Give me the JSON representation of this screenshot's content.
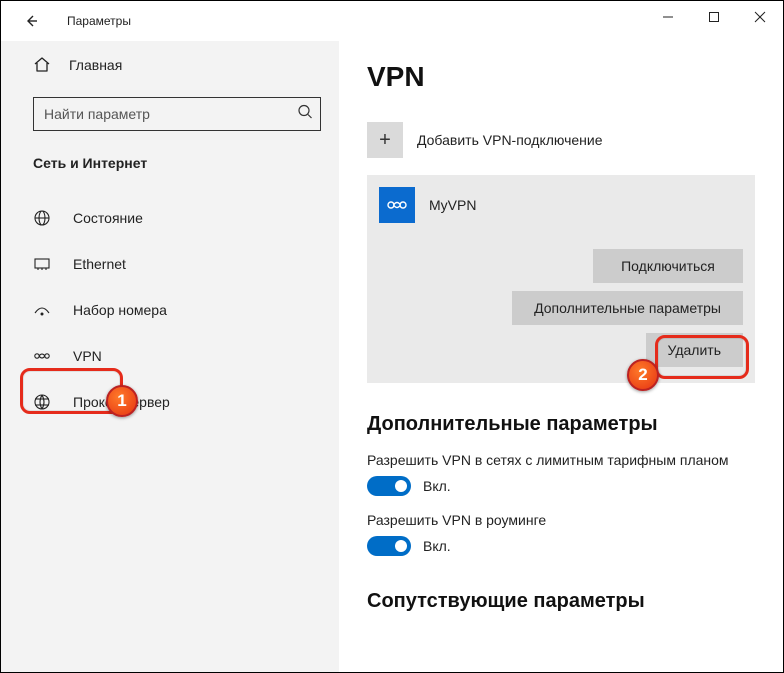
{
  "titlebar": {
    "title": "Параметры"
  },
  "sidebar": {
    "home_label": "Главная",
    "search_placeholder": "Найти параметр",
    "section_title": "Сеть и Интернет",
    "items": [
      {
        "label": "Состояние"
      },
      {
        "label": "Ethernet"
      },
      {
        "label": "Набор номера"
      },
      {
        "label": "VPN"
      },
      {
        "label": "Прокси-сервер"
      }
    ]
  },
  "content": {
    "heading": "VPN",
    "add_vpn_label": "Добавить VPN-подключение",
    "vpn_name": "MyVPN",
    "actions": {
      "connect": "Подключиться",
      "advanced": "Дополнительные параметры",
      "delete": "Удалить"
    },
    "extra_heading": "Дополнительные параметры",
    "toggle1_label": "Разрешить VPN в сетях с лимитным тарифным планом",
    "toggle2_label": "Разрешить VPN в роуминге",
    "toggle_on_text": "Вкл.",
    "related_heading": "Сопутствующие параметры"
  },
  "annotations": {
    "one": "1",
    "two": "2"
  }
}
